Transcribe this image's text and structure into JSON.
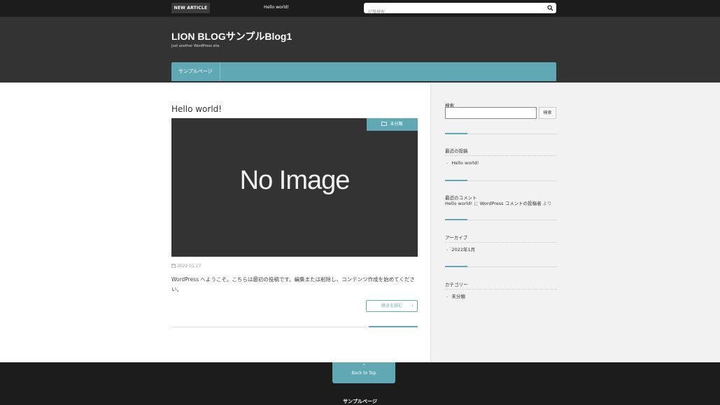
{
  "topbar": {
    "new_article_label": "NEW ARTICLE",
    "new_article_link": "Hello world!",
    "search_placeholder": "記事検索"
  },
  "header": {
    "title": "LION BLOGサンプルBlog1",
    "description": "Just another WordPress site",
    "nav": [
      "サンプルページ"
    ]
  },
  "post": {
    "title": "Hello world!",
    "thumbnail_text": "No Image",
    "category": "未分類",
    "date": "2022.01.17",
    "excerpt": "WordPress へようこそ。こちらは最初の投稿です。編集または削除し、コンテンツ作成を始めてください。",
    "read_more": "続きを読む"
  },
  "sidebar": {
    "search_label": "検索",
    "search_button": "検索",
    "recent_posts_title": "最近の投稿",
    "recent_posts": [
      "Hello world!"
    ],
    "recent_comments_title": "最近のコメント",
    "recent_comment": {
      "post": "Hello world!",
      "mid": " に ",
      "author": "WordPress コメントの投稿者",
      "tail": " より"
    },
    "archives_title": "アーカイブ",
    "archives": [
      "2022年1月"
    ],
    "categories_title": "カテゴリー",
    "categories": [
      "未分類"
    ]
  },
  "footer": {
    "back_to_top": "Back to Top",
    "nav": "サンプルページ"
  },
  "colors": {
    "accent": "#61a8b5",
    "header_bg": "#333333",
    "topbar_bg": "#1c1c1c"
  }
}
